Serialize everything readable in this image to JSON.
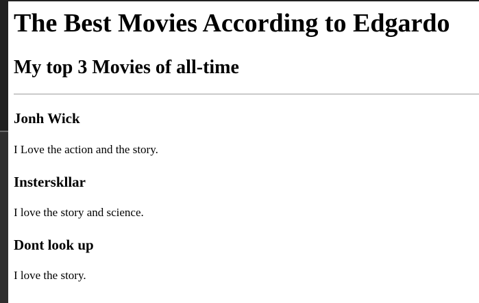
{
  "page": {
    "heading": "The Best Movies According to Edgardo",
    "subheading": "My top 3 Movies of all-time"
  },
  "movies": [
    {
      "title": "Jonh Wick",
      "description": "I Love the action and the story."
    },
    {
      "title": "Insterskllar",
      "description": "I love the story and science."
    },
    {
      "title": "Dont look up",
      "description": "I love the story."
    }
  ],
  "colors": {
    "background": "#ffffff",
    "text": "#000000",
    "divider": "#9a9a9a",
    "window_edge": "#202020"
  }
}
